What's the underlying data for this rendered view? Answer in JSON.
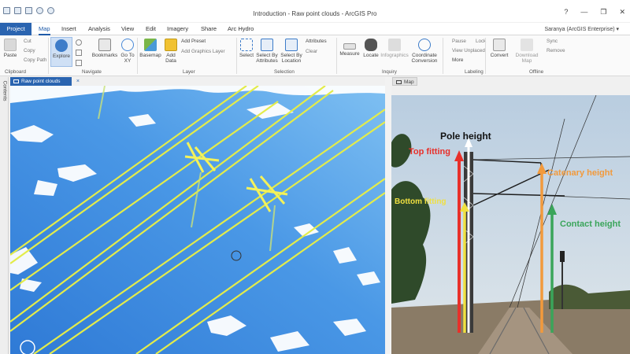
{
  "window": {
    "title": "Introduction - Raw point clouds - ArcGIS Pro",
    "help": "?",
    "minimize": "—",
    "restore": "❐",
    "close": "✕"
  },
  "tabs": [
    "Project",
    "Map",
    "Insert",
    "Analysis",
    "View",
    "Edit",
    "Imagery",
    "Share",
    "Arc Hydro"
  ],
  "user": "Saranya (ArcGIS Enterprise) ▾",
  "ribbon": {
    "clipboard": {
      "paste": "Paste",
      "cut": "Cut",
      "copy": "Copy",
      "copy_path": "Copy Path",
      "label": "Clipboard"
    },
    "navigate": {
      "explore": "Explore",
      "bookmarks": "Bookmarks",
      "goto": "Go To XY",
      "label": "Navigate"
    },
    "layer": {
      "basemap": "Basemap",
      "add_data": "Add Data",
      "add_preset": "Add Preset",
      "add_graphics": "Add Graphics Layer",
      "label": "Layer"
    },
    "selection": {
      "select": "Select",
      "by_attributes": "Select By Attributes",
      "by_location": "Select By Location",
      "attributes": "Attributes",
      "clear": "Clear",
      "label": "Selection"
    },
    "inquiry": {
      "measure": "Measure",
      "locate": "Locate",
      "infographics": "Infographics",
      "coord_conv": "Coordinate Conversion",
      "label": "Inquiry"
    },
    "labeling": {
      "pause": "Pause",
      "lock": "Lock",
      "view_unplaced": "View Unplaced",
      "more": "More",
      "label": "Labeling"
    },
    "offline": {
      "convert": "Convert",
      "download_map": "Download Map",
      "sync": "Sync",
      "remove": "Remove",
      "label": "Offline"
    }
  },
  "side": {
    "contents": "Contents"
  },
  "views": {
    "left": "Raw point clouds",
    "right": "Map",
    "close": "×"
  },
  "photo_labels": {
    "pole": "Pole height",
    "top": "Top fitting",
    "bottom": "Bottom fitting",
    "catenary": "Catenary height",
    "contact": "Contact height"
  },
  "colors": {
    "pole": "#ffffff",
    "top": "#e8302a",
    "bottom": "#f0e040",
    "catenary": "#f29a3c",
    "contact": "#3aa55a",
    "accent": "#2a64b0"
  }
}
